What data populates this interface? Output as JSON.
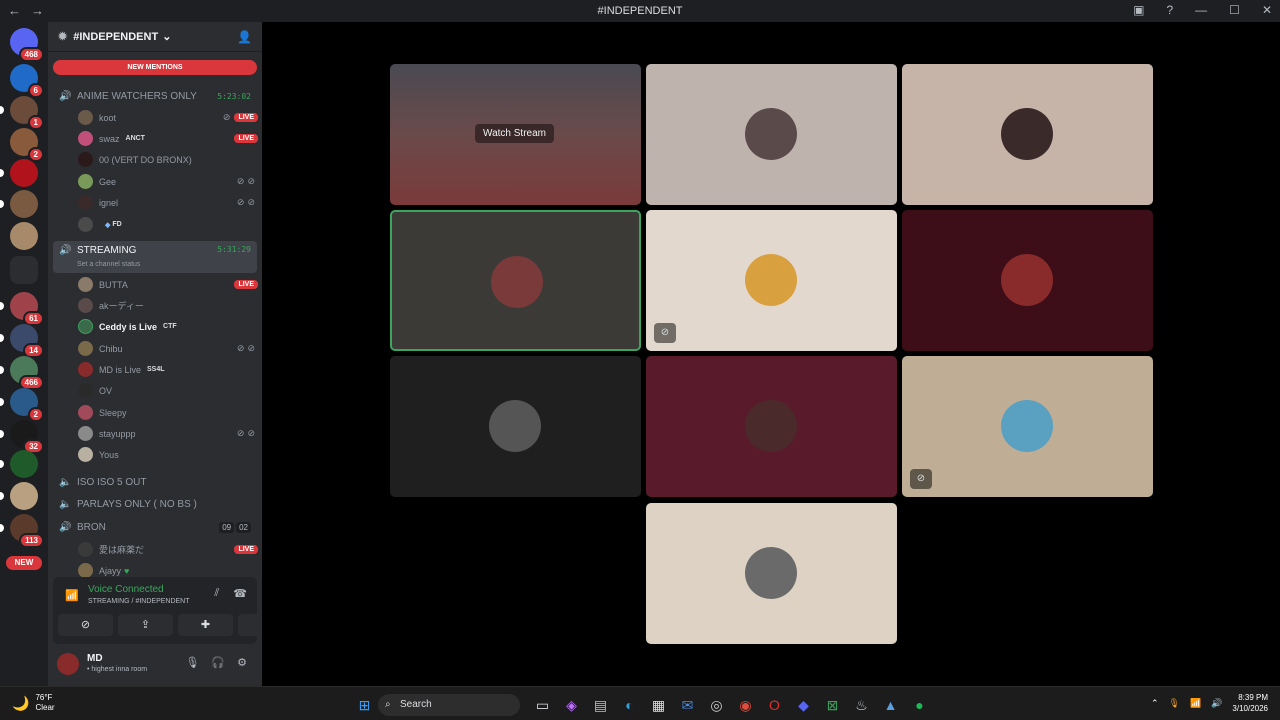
{
  "titlebar": {
    "title": "#INDEPENDENT"
  },
  "server": {
    "name": "#INDEPENDENT",
    "new_mentions": "NEW MENTIONS"
  },
  "servers": [
    {
      "badge": "468"
    },
    {
      "badge": "6"
    },
    {
      "badge": "1"
    },
    {
      "badge": "2"
    },
    {
      "badge": ""
    },
    {
      "badge": ""
    },
    {
      "badge": ""
    },
    {
      "badge": "61"
    },
    {
      "badge": "14"
    },
    {
      "badge": "466"
    },
    {
      "badge": "2"
    },
    {
      "badge": "32"
    },
    {
      "badge": ""
    },
    {
      "badge": ""
    },
    {
      "badge": "113"
    }
  ],
  "servers_new": "NEW",
  "channels": {
    "anime": {
      "name": "ANIME WATCHERS ONLY",
      "timer": "5:23:02"
    },
    "anime_users": [
      {
        "name": "koot",
        "live": "LIVE"
      },
      {
        "name": "swaz",
        "tag": "ANCT",
        "live": "LIVE"
      },
      {
        "name": "00 (VERT DO BRONX)"
      },
      {
        "name": "Gee"
      },
      {
        "name": "ignel"
      },
      {
        "name": "",
        "tag": "FD"
      }
    ],
    "streaming": {
      "name": "STREAMING",
      "timer": "5:31:29",
      "status": "Set a channel status"
    },
    "streaming_users": [
      {
        "name": "BUTTA",
        "live": "LIVE"
      },
      {
        "name": "akーディー"
      },
      {
        "name": "Ceddy is Live",
        "tag": "CTF"
      },
      {
        "name": "Chibu"
      },
      {
        "name": "MD is Live",
        "tag": "SS4L"
      },
      {
        "name": "OV"
      },
      {
        "name": "Sleepy"
      },
      {
        "name": "stayuppp"
      },
      {
        "name": "Yous"
      }
    ],
    "iso": {
      "name": "ISO ISO 5 OUT"
    },
    "parlays": {
      "name": "PARLAYS ONLY ( NO BS )"
    },
    "bron": {
      "name": "BRON",
      "count_a": "09",
      "count_b": "02"
    },
    "bron_users": [
      {
        "name": "愛は麻薬だ",
        "live": "LIVE"
      },
      {
        "name": "Ajayy"
      }
    ]
  },
  "voice": {
    "title": "Voice Connected",
    "subtitle": "STREAMING / #INDEPENDENT"
  },
  "user": {
    "name": "MD",
    "status": "• highest inna room"
  },
  "stage": {
    "watch_label": "Watch Stream"
  },
  "taskbar": {
    "temp": "76°F",
    "weather": "Clear",
    "search": "Search",
    "time": "8:39 PM",
    "date": "3/10/2026"
  },
  "colors": {
    "accent_green": "#3ba55d",
    "red": "#da373c"
  }
}
